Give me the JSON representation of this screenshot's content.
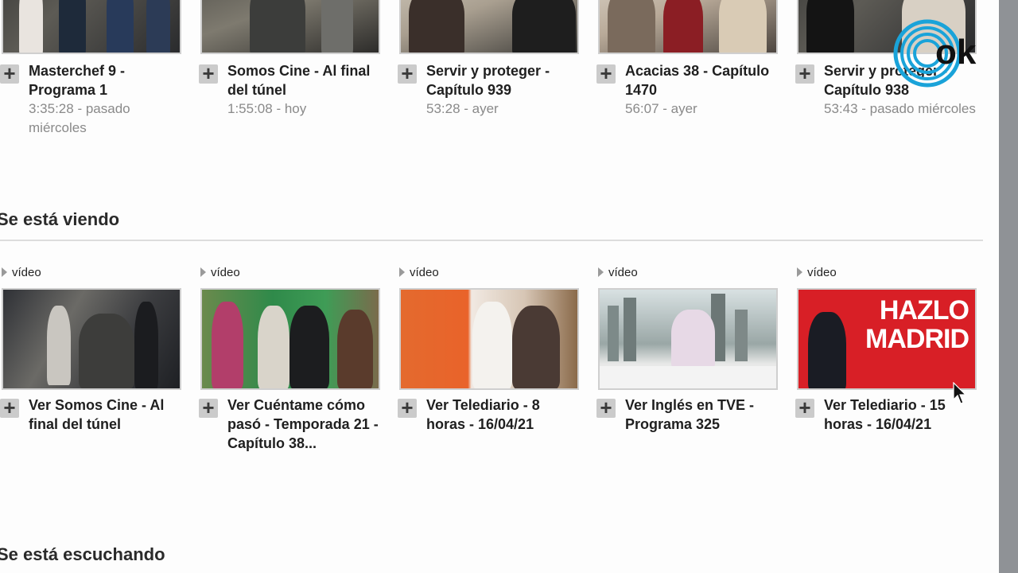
{
  "top_row": [
    {
      "title": "Masterchef 9 - Programa 1",
      "meta": "3:35:28 - pasado miércoles",
      "thumb": "t-dark"
    },
    {
      "title": "Somos Cine - Al final del túnel",
      "meta": "1:55:08 - hoy",
      "thumb": "t-dark2"
    },
    {
      "title": "Servir y proteger - Capítulo 939",
      "meta": "53:28 - ayer",
      "thumb": "t-beige"
    },
    {
      "title": "Acacias 38 - Capítulo 1470",
      "meta": "56:07 - ayer",
      "thumb": "t-pale"
    },
    {
      "title": "Servir y proteger - Capítulo 938",
      "meta": "53:43 - pasado miércoles",
      "thumb": "t-dark"
    }
  ],
  "section_watching": {
    "title": "Se está viendo",
    "items": [
      {
        "tag": "vídeo",
        "title": "Ver Somos Cine - Al final del túnel",
        "thumb": "t-scene1"
      },
      {
        "tag": "vídeo",
        "title": "Ver Cuéntame cómo pasó - Temporada 21 - Capítulo 38...",
        "thumb": "t-green"
      },
      {
        "tag": "vídeo",
        "title": "Ver Telediario - 8 horas - 16/04/21",
        "thumb": "t-orange"
      },
      {
        "tag": "vídeo",
        "title": "Ver Inglés en TVE - Programa 325",
        "thumb": "t-city"
      },
      {
        "tag": "vídeo",
        "title": "Ver Telediario - 15 horas - 16/04/21",
        "thumb": "t-red"
      }
    ]
  },
  "section_listening": {
    "title": "Se está escuchando"
  },
  "thumb_text": {
    "hazlo_line1": "HAZLO",
    "hazlo_line2": "MADRID"
  },
  "logo": {
    "text": "ok",
    "color": "#1aa3d9"
  },
  "icons": {
    "add": "plus-icon",
    "video": "play-triangle-icon",
    "cursor": "mouse-pointer-icon"
  }
}
